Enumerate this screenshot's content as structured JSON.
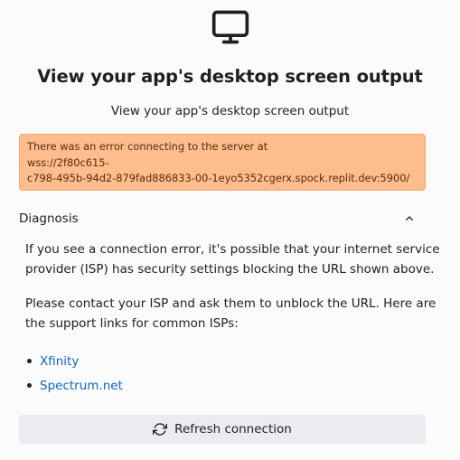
{
  "header": {
    "icon": "monitor-icon",
    "title": "View your app's desktop screen output",
    "subtitle": "View your app's desktop screen output"
  },
  "error": {
    "line1": "There was an error connecting to the server at",
    "line2": "wss://2f80c615-",
    "line3": "c798-495b-94d2-879fad886833-00-1eyo5352cgerx.spock.replit.dev:5900/",
    "color": "#fdbd8c"
  },
  "diagnosis": {
    "title": "Diagnosis",
    "expanded": true,
    "icon": "chevron-up-icon",
    "paragraph1": {
      "line1": "If you see a connection error, it's possible that your internet service",
      "line2": "provider (ISP) has security settings blocking the URL shown above."
    },
    "paragraph2": {
      "line1": "Please contact your ISP and ask them to unblock the URL. Here are",
      "line2": "the support links for common ISPs:"
    },
    "links": [
      {
        "label": "Xfinity"
      },
      {
        "label": "Spectrum.net"
      }
    ],
    "link_color": "#0f66c4"
  },
  "actions": {
    "refresh_label": "Refresh connection",
    "refresh_icon": "refresh-icon"
  }
}
